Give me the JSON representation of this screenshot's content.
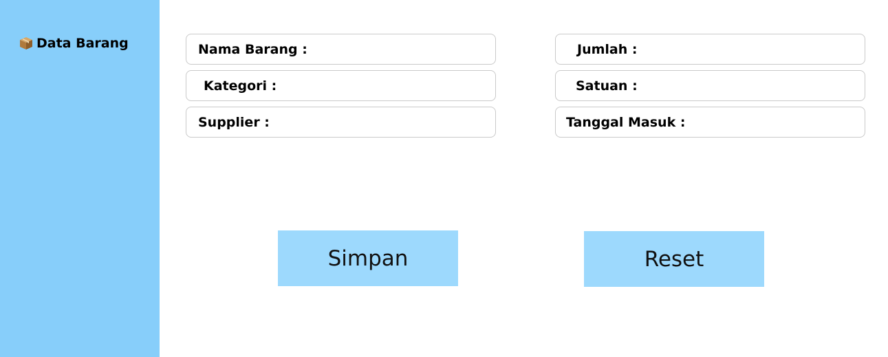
{
  "sidebar": {
    "items": [
      {
        "label": "Data Barang",
        "icon": "package-icon"
      }
    ]
  },
  "form": {
    "nama_barang": {
      "label": "Nama Barang   :",
      "value": ""
    },
    "kategori": {
      "label": "Kategori    :",
      "value": ""
    },
    "supplier": {
      "label": "Supplier    :",
      "value": ""
    },
    "jumlah": {
      "label": "Jumlah    :",
      "value": ""
    },
    "satuan": {
      "label": "Satuan  :",
      "value": ""
    },
    "tanggal_masuk": {
      "label": "Tanggal Masuk   :",
      "value": ""
    }
  },
  "actions": {
    "save_label": "Simpan",
    "reset_label": "Reset"
  },
  "colors": {
    "sidebar_bg": "#87cefa",
    "button_bg": "#9dd9fd",
    "field_border": "#c9c9c9"
  }
}
